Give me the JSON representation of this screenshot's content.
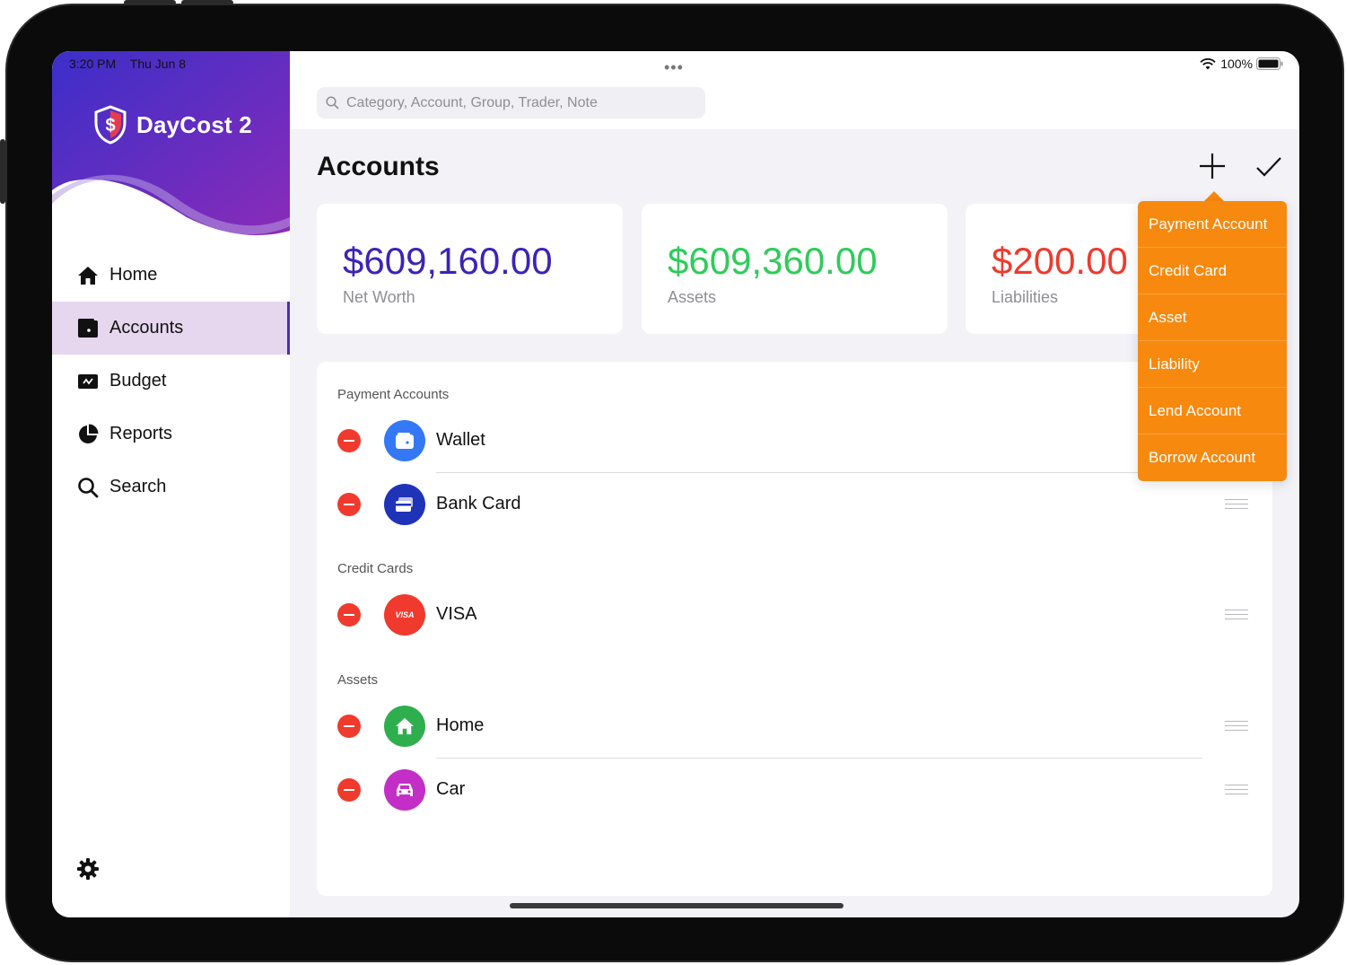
{
  "status_bar": {
    "time": "3:20 PM",
    "date": "Thu Jun 8",
    "battery": "100%"
  },
  "app": {
    "name": "DayCost 2"
  },
  "sidebar": {
    "items": [
      {
        "label": "Home",
        "icon": "house-icon"
      },
      {
        "label": "Accounts",
        "icon": "wallet-icon",
        "active": true
      },
      {
        "label": "Budget",
        "icon": "budget-icon"
      },
      {
        "label": "Reports",
        "icon": "pie-chart-icon"
      },
      {
        "label": "Search",
        "icon": "magnifier-icon"
      }
    ],
    "settings_icon": "gear-icon"
  },
  "search": {
    "placeholder": "Category, Account, Group, Trader, Note"
  },
  "page": {
    "title": "Accounts"
  },
  "summary": [
    {
      "amount": "$609,160.00",
      "label": "Net Worth",
      "color": "#3b24b8"
    },
    {
      "amount": "$609,360.00",
      "label": "Assets",
      "color": "#2ecc5a"
    },
    {
      "amount": "$200.00",
      "label": "Liabilities",
      "color": "#ef3a2d"
    }
  ],
  "sections": [
    {
      "title": "Payment Accounts",
      "accounts": [
        {
          "name": "Wallet",
          "icon": "wallet-icon",
          "color": "#3478f6"
        },
        {
          "name": "Bank Card",
          "icon": "bank-card-icon",
          "color": "#1f33b8"
        }
      ]
    },
    {
      "title": "Credit Cards",
      "accounts": [
        {
          "name": "VISA",
          "icon": "visa-icon",
          "color": "#f03a2e",
          "icon_text": "VISA"
        }
      ]
    },
    {
      "title": "Assets",
      "accounts": [
        {
          "name": "Home",
          "icon": "house-icon",
          "color": "#2fae4e"
        },
        {
          "name": "Car",
          "icon": "car-icon",
          "color": "#c32fc6"
        }
      ]
    }
  ],
  "add_menu": {
    "items": [
      "Payment Account",
      "Credit Card",
      "Asset",
      "Liability",
      "Lend Account",
      "Borrow Account"
    ],
    "color": "#f7890f"
  }
}
